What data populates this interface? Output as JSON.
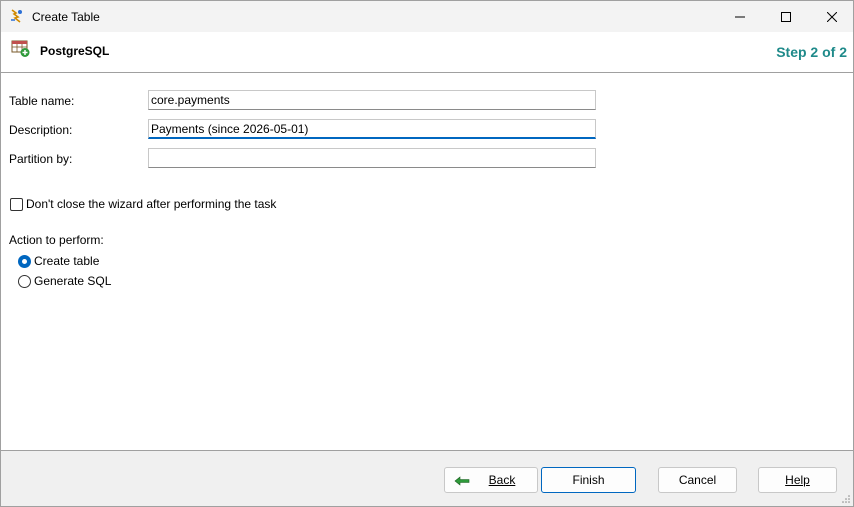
{
  "window": {
    "title": "Create Table"
  },
  "header": {
    "db_name": "PostgreSQL",
    "step": "Step 2 of 2"
  },
  "form": {
    "table_name_label": "Table name:",
    "table_name_value": "core.payments",
    "description_label": "Description:",
    "description_value": "Payments (since 2026-05-01)",
    "partition_label": "Partition by:",
    "partition_value": ""
  },
  "options": {
    "keep_open_label": "Don't close the wizard after performing the task",
    "keep_open_checked": false,
    "action_label": "Action to perform:",
    "actions": [
      {
        "label": "Create table",
        "selected": true
      },
      {
        "label": "Generate SQL",
        "selected": false
      }
    ]
  },
  "footer": {
    "back_label": "Back",
    "finish_label": "Finish",
    "cancel_label": "Cancel",
    "help_label": "Help"
  },
  "colors": {
    "accent": "#0067c0",
    "step": "#1f8a8a"
  }
}
